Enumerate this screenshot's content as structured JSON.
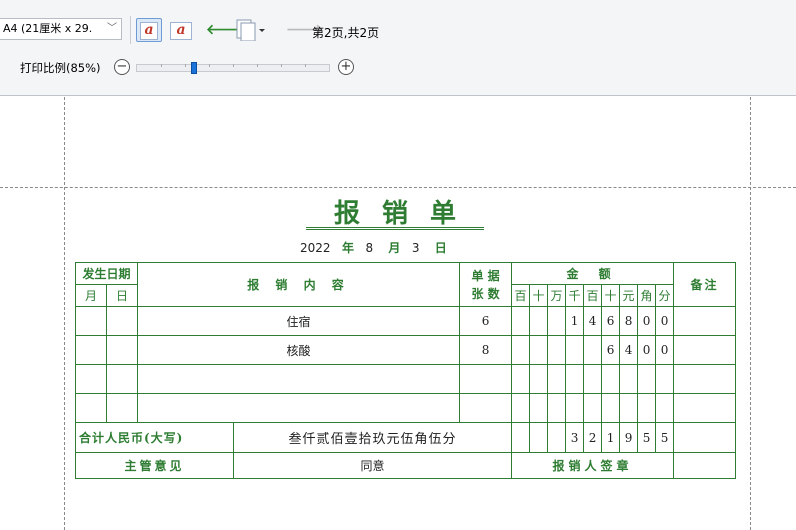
{
  "toolbar": {
    "paper_size": "A4 (21厘米 x 29.",
    "page_status": "第2页,共2页",
    "zoom_label": "打印比例(85%)",
    "zoom_minus": "−",
    "zoom_plus": "+",
    "zoom_percent": 85
  },
  "form": {
    "title": "报销单",
    "date": {
      "year": "2022",
      "year_unit": "年",
      "month": "8",
      "month_unit": "月",
      "day": "3",
      "day_unit": "日"
    },
    "headers": {
      "date_occurred": "发生日期",
      "month": "月",
      "day": "日",
      "content": "报 销 内 容",
      "doc_count_line1": "单 据",
      "doc_count_line2": "张 数",
      "amount": "金 额",
      "digits": [
        "百",
        "十",
        "万",
        "千",
        "百",
        "十",
        "元",
        "角",
        "分"
      ],
      "remarks": "备注"
    },
    "rows": [
      {
        "content": "住宿",
        "count": "6",
        "digits": [
          "",
          "",
          "",
          "1",
          "4",
          "6",
          "8",
          "0",
          "0"
        ]
      },
      {
        "content": "核酸",
        "count": "8",
        "digits": [
          "",
          "",
          "",
          "",
          "",
          "6",
          "4",
          "0",
          "0"
        ]
      },
      {
        "content": "",
        "count": "",
        "digits": [
          "",
          "",
          "",
          "",
          "",
          "",
          "",
          "",
          ""
        ]
      },
      {
        "content": "",
        "count": "",
        "digits": [
          "",
          "",
          "",
          "",
          "",
          "",
          "",
          "",
          ""
        ]
      }
    ],
    "total": {
      "label": "合计人民币(大写)",
      "in_words": "叁仟贰佰壹拾玖元伍角伍分",
      "digits": [
        "",
        "",
        "",
        "3",
        "2",
        "1",
        "9",
        "5",
        "5"
      ]
    },
    "footer": {
      "supervisor_label": "主管意见",
      "supervisor_opinion": "同意",
      "claimant_sign_label": "报销人签章"
    }
  }
}
